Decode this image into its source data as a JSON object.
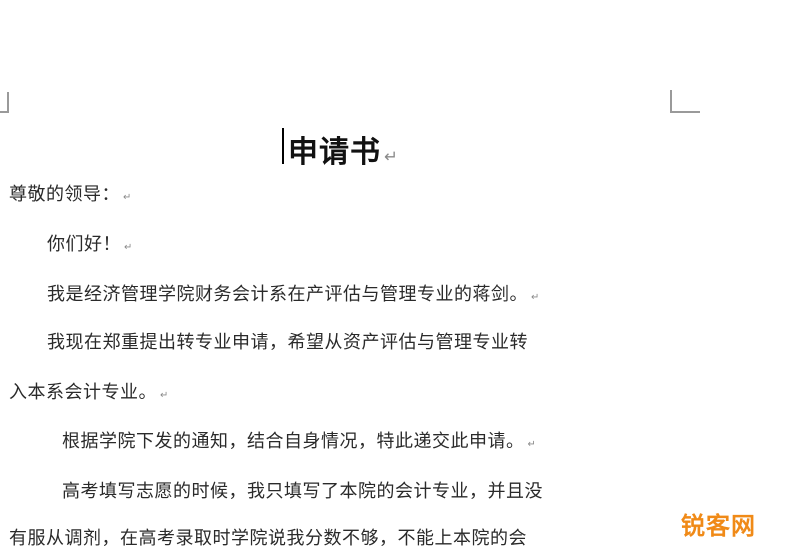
{
  "document": {
    "title": "申请书",
    "paragraph_mark": "↵",
    "lines": [
      "尊敬的领导：",
      "你们好！",
      "我是经济管理学院财务会计系在产评估与管理专业的蒋剑。",
      "我现在郑重提出转专业申请，希望从资产评估与管理专业转",
      "入本系会计专业。",
      "根据学院下发的通知，结合自身情况，特此递交此申请。",
      "高考填写志愿的时候，我只填写了本院的会计专业，并且没",
      "有服从调剂，在高考录取时学院说我分数不够，不能上本院的会"
    ]
  },
  "watermark": {
    "text": "锐客网",
    "color": "#f08a17"
  }
}
